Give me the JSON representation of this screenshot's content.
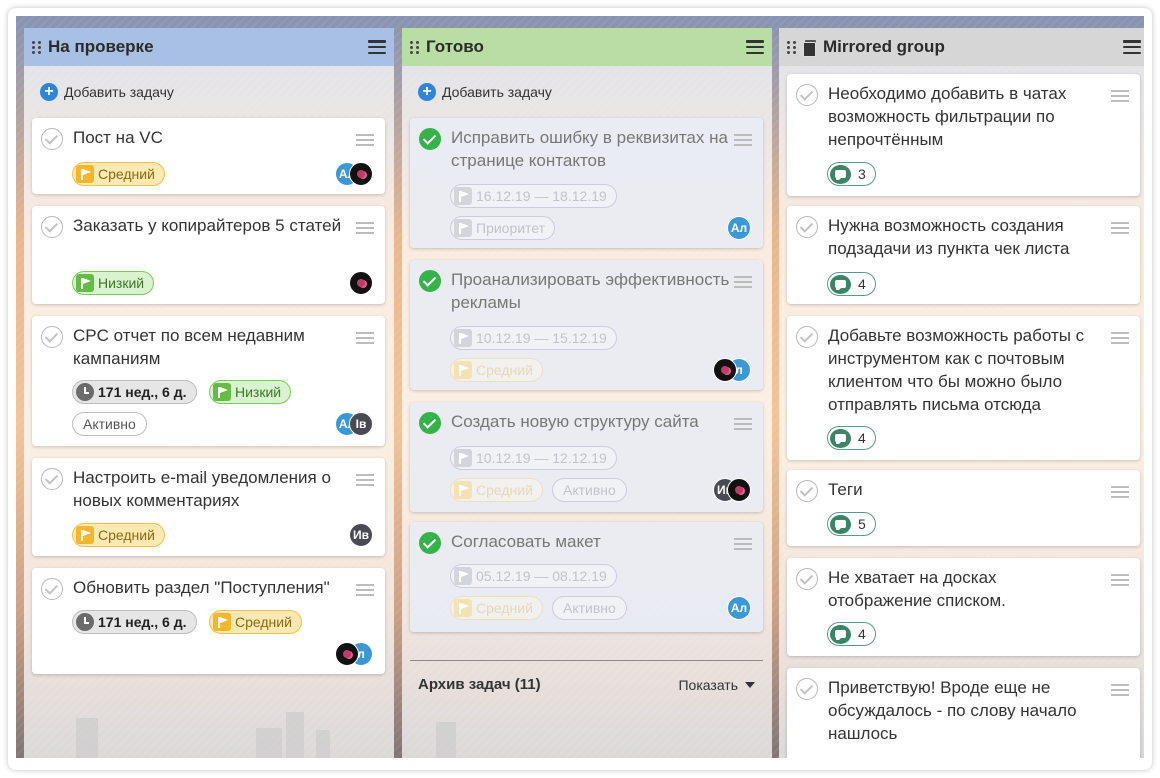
{
  "columns": [
    {
      "title": "На проверке",
      "header_color": "#a8c0e4",
      "add_label": "Добавить задачу",
      "cards": [
        {
          "title": "Пост на VC",
          "priority": "Средний",
          "avatars": [
            "Ал",
            ""
          ]
        },
        {
          "title": "Заказать у копирайтеров 5 статей",
          "priority": "Низкий",
          "avatars": [
            ""
          ]
        },
        {
          "title": "CPC отчет по всем недавним кампаниям",
          "timer": "171 нед., 6 д.",
          "priority": "Низкий",
          "status": "Активно",
          "avatars": [
            "Ал",
            "Ів"
          ]
        },
        {
          "title": "Настроить e-mail уведомления о новых комментариях",
          "priority": "Средний",
          "avatars": [
            "Ив"
          ]
        },
        {
          "title": "Обновить раздел \"Поступления\"",
          "timer": "171 нед., 6 д.",
          "priority": "Средний",
          "avatars": [
            "",
            "л"
          ]
        }
      ]
    },
    {
      "title": "Готово",
      "header_color": "#b9dea3",
      "add_label": "Добавить задачу",
      "cards": [
        {
          "title": "Исправить ошибку в реквизитах на странице контактов",
          "dates": "16.12.19 — 18.12.19",
          "priority": "Приоритет",
          "avatars": [
            "Ал"
          ]
        },
        {
          "title": "Проанализировать эффективность рекламы",
          "dates": "10.12.19 — 15.12.19",
          "priority": "Средний",
          "avatars": [
            "",
            "л"
          ]
        },
        {
          "title": "Создать новую структуру сайта",
          "dates": "10.12.19 — 12.12.19",
          "priority": "Средний",
          "status": "Активно",
          "avatars": [
            "Ив",
            ""
          ]
        },
        {
          "title": "Согласовать макет",
          "dates": "05.12.19 — 08.12.19",
          "priority": "Средний",
          "status": "Активно",
          "avatars": [
            "Ал"
          ]
        }
      ],
      "archive_label": "Архив задач (11)",
      "archive_show": "Показать"
    },
    {
      "title": "Mirrored group",
      "header_color": "#d6d6d6",
      "cards": [
        {
          "title": "Необходимо добавить в чатах возможность фильтрации по непрочтённым",
          "comments": "3"
        },
        {
          "title": "Нужна возможность создания подзадачи из пункта чек листа",
          "comments": "4"
        },
        {
          "title": "Добавьте возможность работы с инструментом как с почтовым клиентом что бы можно было отправлять письма отсюда",
          "comments": "4"
        },
        {
          "title": "Теги",
          "comments": "5"
        },
        {
          "title": "Не хватает на досках отображение списком.",
          "comments": "4"
        },
        {
          "title": "Приветствую! Вроде еще не обсуждалось - по слову начало нашлось"
        }
      ]
    }
  ]
}
